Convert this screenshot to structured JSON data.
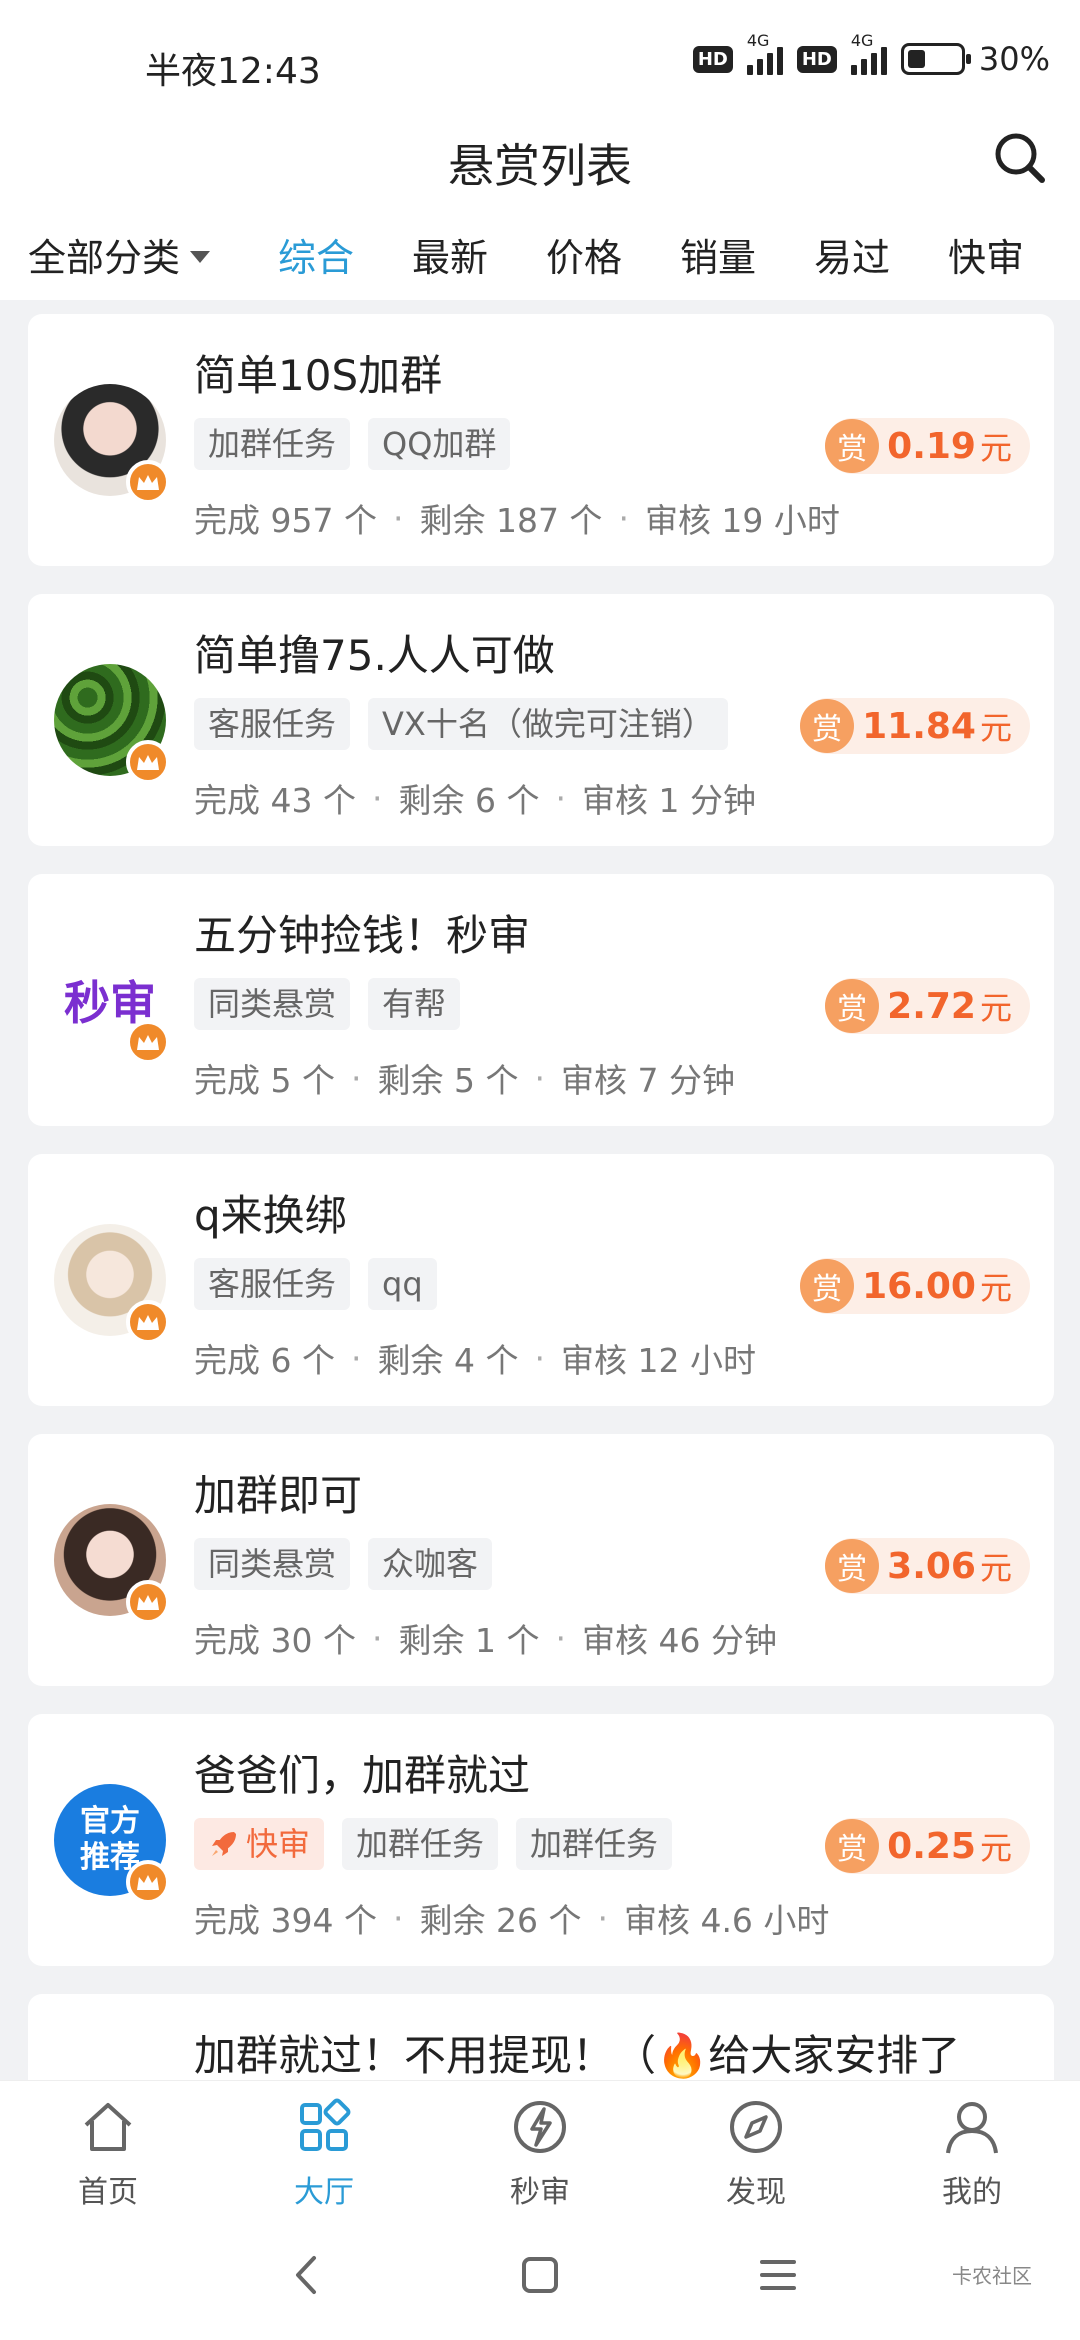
{
  "status_bar": {
    "time": "半夜12:43",
    "hd1": "HD",
    "net1": "4G",
    "hd2": "HD",
    "net2": "4G",
    "battery": "30%"
  },
  "header": {
    "title": "悬赏列表"
  },
  "filters": {
    "all_label": "全部分类",
    "tabs": [
      "综合",
      "最新",
      "价格",
      "销量",
      "易过",
      "快审"
    ],
    "active_tab": "综合"
  },
  "cards": [
    {
      "title": "简单10S加群",
      "tags": [
        "加群任务",
        "QQ加群"
      ],
      "reward_icon": "赏",
      "amount": "0.19",
      "unit": "元",
      "completed": "完成 957 个",
      "remaining": "剩余 187 个",
      "review": "审核 19 小时",
      "avatar": "girl-portrait"
    },
    {
      "title": "简单撸75.人人可做",
      "tags": [
        "客服任务",
        "VX十名（做完可注销）"
      ],
      "reward_icon": "赏",
      "amount": "11.84",
      "unit": "元",
      "completed": "完成 43 个",
      "remaining": "剩余 6 个",
      "review": "审核 1 分钟",
      "avatar": "watermelons"
    },
    {
      "title": "五分钟捡钱！秒审",
      "tags": [
        "同类悬赏",
        "有帮"
      ],
      "reward_icon": "赏",
      "amount": "2.72",
      "unit": "元",
      "completed": "完成 5 个",
      "remaining": "剩余 5 个",
      "review": "审核 7 分钟",
      "avatar_text": "秒审",
      "avatar": "text-logo"
    },
    {
      "title": "q来换绑",
      "tags": [
        "客服任务",
        "qq"
      ],
      "reward_icon": "赏",
      "amount": "16.00",
      "unit": "元",
      "completed": "完成 6 个",
      "remaining": "剩余 4 个",
      "review": "审核 12 小时",
      "avatar": "anime-girl"
    },
    {
      "title": "加群即可",
      "tags": [
        "同类悬赏",
        "众咖客"
      ],
      "reward_icon": "赏",
      "amount": "3.06",
      "unit": "元",
      "completed": "完成 30 个",
      "remaining": "剩余 1 个",
      "review": "审核 46 分钟",
      "avatar": "girl-portrait-2"
    },
    {
      "title": "爸爸们，加群就过",
      "fast_tag": "快审",
      "tags": [
        "加群任务",
        "加群任务"
      ],
      "reward_icon": "赏",
      "amount": "0.25",
      "unit": "元",
      "completed": "完成 394 个",
      "remaining": "剩余 26 个",
      "review": "审核 4.6 小时",
      "avatar_text": "官方推荐",
      "avatar": "official-badge"
    },
    {
      "title": "加群就过！不用提现！（🔥给大家安排了"
    }
  ],
  "bottom_nav": [
    {
      "label": "首页",
      "icon": "home-icon"
    },
    {
      "label": "大厅",
      "icon": "grid-icon",
      "active": true
    },
    {
      "label": "秒审",
      "icon": "flash-icon"
    },
    {
      "label": "发现",
      "icon": "compass-icon"
    },
    {
      "label": "我的",
      "icon": "person-icon"
    }
  ],
  "watermark": "卡农社区",
  "colors": {
    "accent": "#2a9bd6",
    "reward": "#f2652c",
    "reward_bg": "#fdeee6",
    "crown": "#f08a2a"
  }
}
